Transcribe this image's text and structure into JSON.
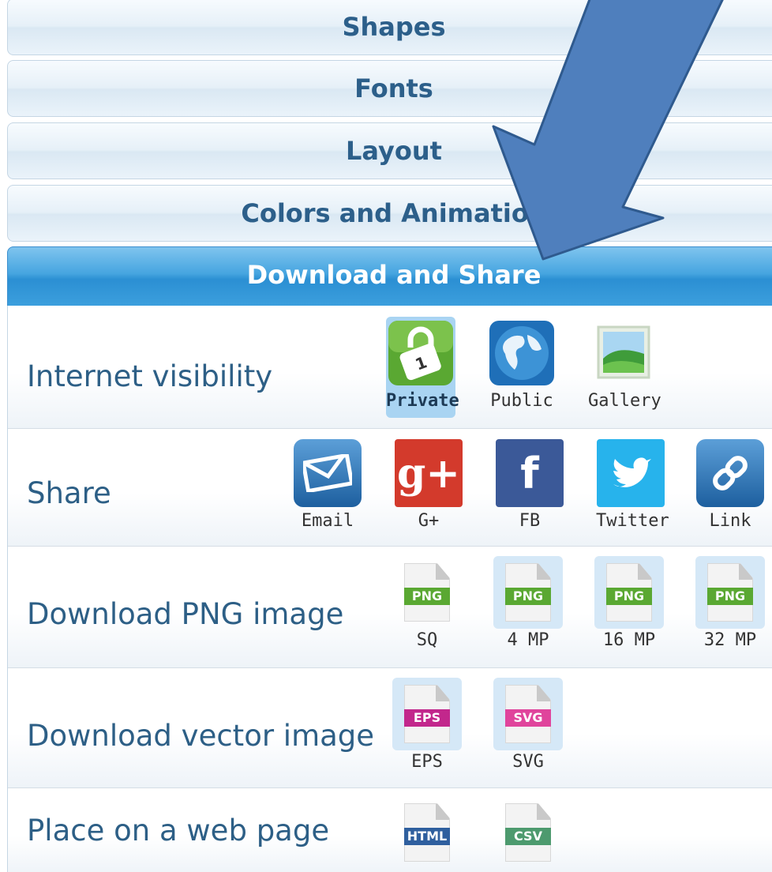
{
  "accordion": {
    "shapes": "Shapes",
    "fonts": "Fonts",
    "layout": "Layout",
    "colors": "Colors and Animation",
    "download": "Download and Share"
  },
  "rows": {
    "visibility": {
      "label": "Internet visibility",
      "options": [
        "Private",
        "Public",
        "Gallery"
      ],
      "selected": "Private"
    },
    "share": {
      "label": "Share",
      "options": [
        "Email",
        "G+",
        "FB",
        "Twitter",
        "Link"
      ]
    },
    "png": {
      "label": "Download PNG image",
      "tag": "PNG",
      "options": [
        "SQ",
        "4 MP",
        "16 MP",
        "32 MP"
      ]
    },
    "vector": {
      "label": "Download vector image",
      "options": [
        "EPS",
        "SVG"
      ],
      "tags": [
        "EPS",
        "SVG"
      ]
    },
    "web": {
      "label": "Place on a web page",
      "tags": [
        "HTML",
        "CSV"
      ]
    }
  },
  "colors": {
    "header_text": "#2c5f8a",
    "active_header": "#2b8fd3",
    "label_text": "#2d5f86",
    "arrow_fill": "#4f7fbd",
    "arrow_stroke": "#2f5a8e",
    "png_tag": "#5aa832",
    "eps_tag": "#c2278c",
    "svg_tag": "#e0449c",
    "html_tag": "#2f5f9e",
    "csv_tag": "#4d9a6e"
  }
}
